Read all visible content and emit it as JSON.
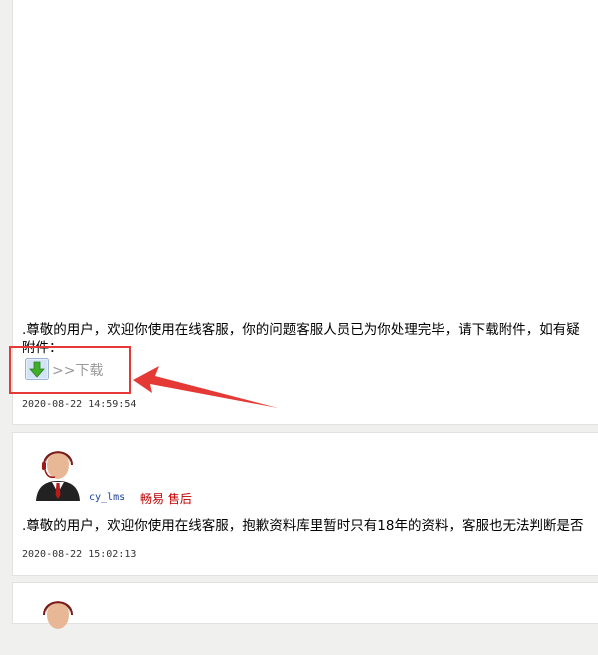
{
  "messages": [
    {
      "text_line1": ".尊敬的用户，欢迎你使用在线客服，你的问题客服人员已为你处理完毕，请下载附件，如有疑",
      "text_line2": "附件：",
      "download_label": ">>下载",
      "timestamp": "2020-08-22 14:59:54"
    },
    {
      "username": "cy_lms",
      "role": "畅易 售后",
      "text": ".尊敬的用户，欢迎你使用在线客服，抱歉资料库里暂时只有18年的资料，客服也无法判断是否",
      "timestamp": "2020-08-22 15:02:13"
    }
  ],
  "icons": {
    "download": "download-icon",
    "avatar": "agent-avatar-icon"
  },
  "colors": {
    "highlight": "#e53935",
    "username": "#1a3fa0",
    "role": "#c00000"
  }
}
